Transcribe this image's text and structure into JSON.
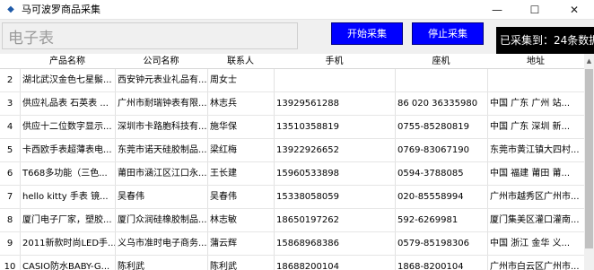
{
  "window": {
    "title": "马可波罗商品采集",
    "controls": {
      "minimize": "—",
      "maximize": "☐",
      "close": "✕"
    }
  },
  "toolbar": {
    "search_value": "电子表",
    "start_label": "开始采集",
    "stop_label": "停止采集",
    "counter_text": "已采集到：24条数据"
  },
  "table": {
    "columns": [
      "",
      "产品名称",
      "公司名称",
      "联系人",
      "手机",
      "座机",
      "地址"
    ],
    "rows": [
      [
        "2",
        "湖北武汉金色七星鬃...",
        "西安钟元表业礼品有...",
        "周女士",
        "",
        "",
        ""
      ],
      [
        "3",
        "供应礼品表 石英表 ...",
        "广州市耐瑞钟表有限...",
        "林志兵",
        "13929561288",
        "86 020 36335980",
        "中国 广东 广州  站..."
      ],
      [
        "4",
        "供应十二位数字显示...",
        "深圳市卡路胞科技有...",
        "施华保",
        "13510358819",
        "0755-85280819",
        "中国 广东 深圳  新..."
      ],
      [
        "5",
        "卡西欧手表超薄表电...",
        "东莞市诺天硅胶制品...",
        "梁红梅",
        "13922926652",
        "0769-83067190",
        "东莞市黄江镇大四村..."
      ],
      [
        "6",
        "T668多功能（三色...",
        "莆田市涵江区江口永...",
        "王长建",
        "15960533898",
        "0594-3788085",
        "中国 福建 莆田  莆..."
      ],
      [
        "7",
        "hello kitty 手表 镜...",
        "吴春伟",
        "吴春伟",
        "15338058059",
        "020-85558994",
        "广州市越秀区广州市..."
      ],
      [
        "8",
        "厦门电子厂家，塑胶...",
        "厦门众润硅橡胶制品...",
        "林志敏",
        "18650197262",
        "592-6269981",
        "厦门集美区灌口灌南..."
      ],
      [
        "9",
        "2011新款时尚LED手...",
        "义乌市准时电子商务...",
        "蒲云辉",
        "15868968386",
        "0579-85198306",
        "中国 浙江 金华  义..."
      ],
      [
        "10",
        "CASIO防水BABY-G...",
        "陈利武",
        "陈利武",
        "18688200104",
        "1868-8200104",
        "广州市白云区广州市..."
      ]
    ]
  }
}
